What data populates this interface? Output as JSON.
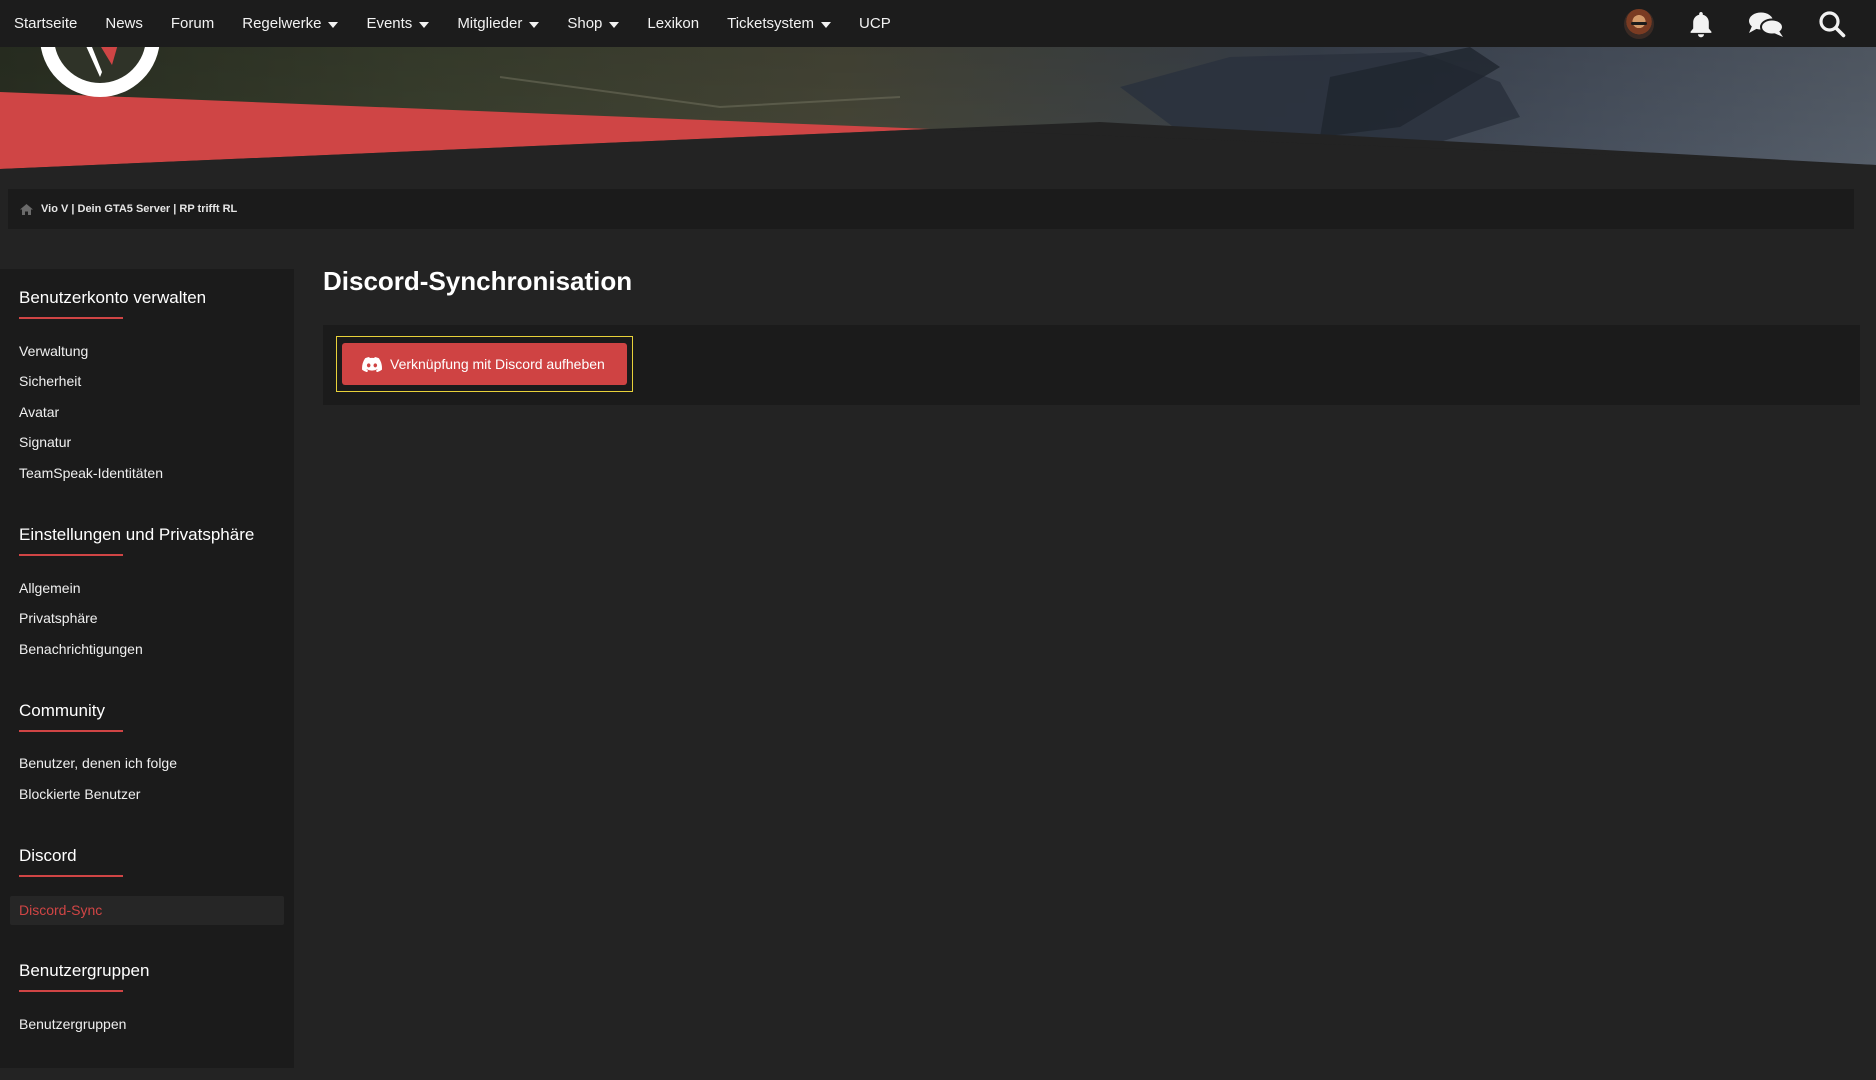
{
  "nav": {
    "items": [
      {
        "label": "Startseite",
        "dropdown": false
      },
      {
        "label": "News",
        "dropdown": false
      },
      {
        "label": "Forum",
        "dropdown": false
      },
      {
        "label": "Regelwerke",
        "dropdown": true
      },
      {
        "label": "Events",
        "dropdown": true
      },
      {
        "label": "Mitglieder",
        "dropdown": true
      },
      {
        "label": "Shop",
        "dropdown": true
      },
      {
        "label": "Lexikon",
        "dropdown": false
      },
      {
        "label": "Ticketsystem",
        "dropdown": true
      },
      {
        "label": "UCP",
        "dropdown": false
      }
    ],
    "icons": [
      "user-avatar",
      "bell-icon",
      "chat-icon",
      "search-icon"
    ]
  },
  "breadcrumb": {
    "icon": "home-icon",
    "text": "Vio V | Dein GTA5 Server | RP trifft RL"
  },
  "sidebar": {
    "sections": [
      {
        "heading": "Benutzerkonto verwalten",
        "links": [
          "Verwaltung",
          "Sicherheit",
          "Avatar",
          "Signatur",
          "TeamSpeak-Identitäten"
        ]
      },
      {
        "heading": "Einstellungen und Privatsphäre",
        "links": [
          "Allgemein",
          "Privatsphäre",
          "Benachrichtigungen"
        ]
      },
      {
        "heading": "Community",
        "links": [
          "Benutzer, denen ich folge",
          "Blockierte Benutzer"
        ]
      },
      {
        "heading": "Discord",
        "links": [
          "Discord-Sync"
        ]
      },
      {
        "heading": "Benutzergruppen",
        "links": [
          "Benutzergruppen"
        ]
      }
    ],
    "active_link": "Discord-Sync"
  },
  "main": {
    "title": "Discord-Synchronisation",
    "button_label": "Verknüpfung mit Discord aufheben",
    "button_icon": "discord-icon"
  },
  "colors": {
    "accent": "#d04545",
    "nav_bg": "#1c1c1c",
    "page_bg": "#232323",
    "panel_bg": "#1b1b1b",
    "highlight": "#e8d23a"
  }
}
